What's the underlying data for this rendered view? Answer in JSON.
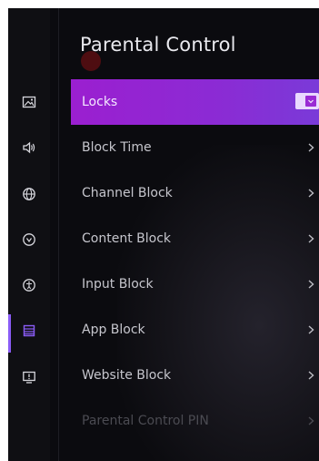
{
  "screen_title": "Parental Control",
  "rail": {
    "items": [
      {
        "icon": "picture-icon"
      },
      {
        "icon": "sound-icon"
      },
      {
        "icon": "network-icon"
      },
      {
        "icon": "power-icon"
      },
      {
        "icon": "accessibility-icon"
      },
      {
        "icon": "system-list-icon"
      },
      {
        "icon": "support-icon"
      }
    ],
    "active_index": 5
  },
  "menu": {
    "items": [
      {
        "label": "Locks",
        "control": "toggle",
        "state": "on"
      },
      {
        "label": "Block Time",
        "control": "chevron"
      },
      {
        "label": "Channel Block",
        "control": "chevron"
      },
      {
        "label": "Content Block",
        "control": "chevron"
      },
      {
        "label": "Input Block",
        "control": "chevron"
      },
      {
        "label": "App Block",
        "control": "chevron"
      },
      {
        "label": "Website Block",
        "control": "chevron"
      },
      {
        "label": "Parental Control PIN",
        "control": "chevron",
        "disabled": true
      }
    ],
    "selected_index": 0
  },
  "colors": {
    "accent": "#8a5cf6",
    "selected_start": "#9b1fd0",
    "selected_end": "#7a3ad8",
    "background": "#0b0b0f"
  }
}
